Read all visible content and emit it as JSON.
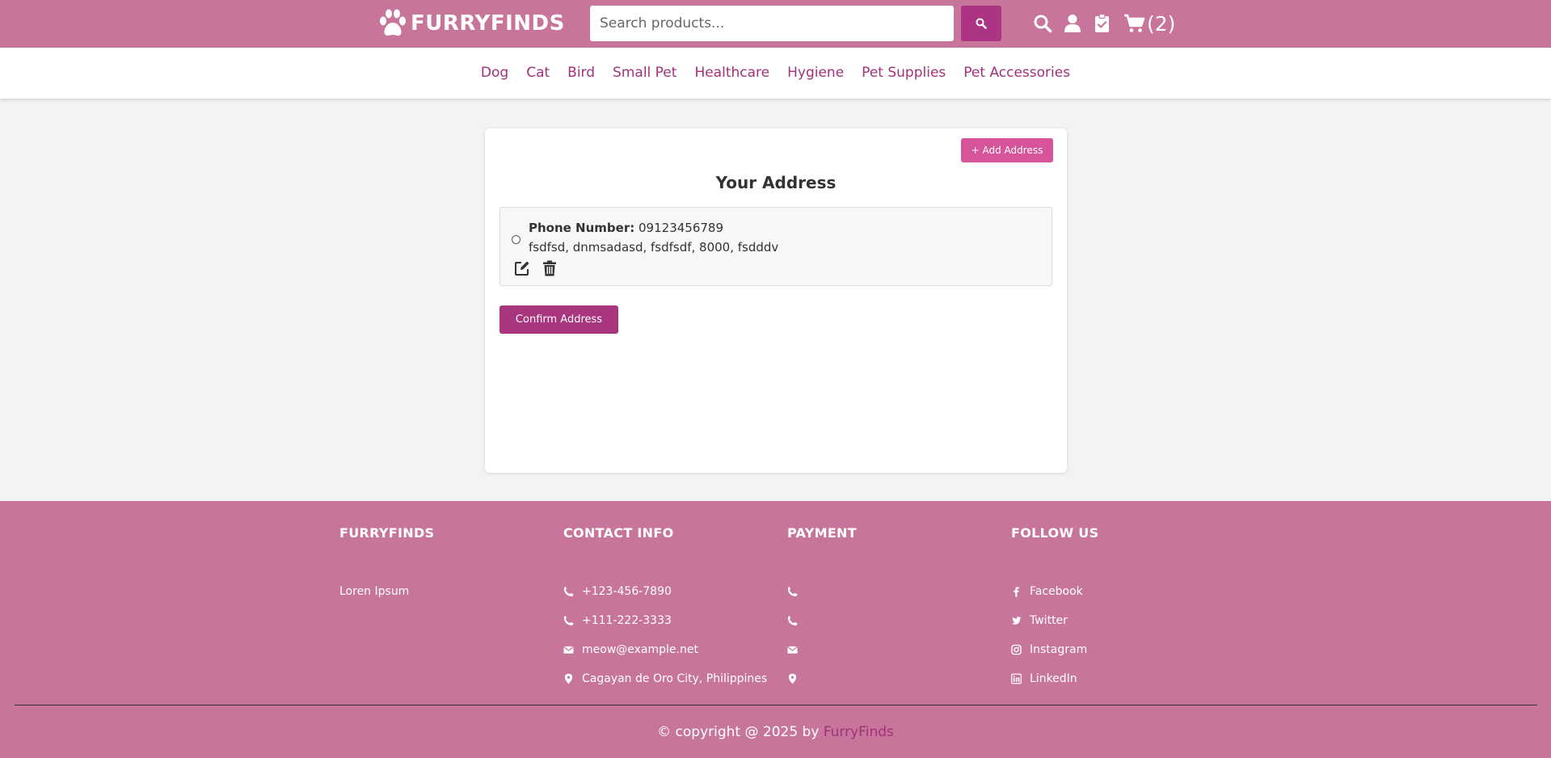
{
  "header": {
    "logo_text": "FURRYFINDS",
    "search_placeholder": "Search products...",
    "cart_count": "(2)"
  },
  "nav": [
    "Dog",
    "Cat",
    "Bird",
    "Small Pet",
    "Healthcare",
    "Hygiene",
    "Pet Supplies",
    "Pet Accessories"
  ],
  "address_card": {
    "add_button": "+ Add Address",
    "title": "Your Address",
    "entry": {
      "phone_label": "Phone Number:",
      "phone_value": "09123456789",
      "address": "fsdfsd, dnmsadasd, fsdfsdf, 8000, fsdddv"
    },
    "confirm_button": "Confirm Address"
  },
  "footer": {
    "col1_title": "FURRYFINDS",
    "col1_text": "Loren Ipsum",
    "col2_title": "CONTACT INFO",
    "contact": [
      "+123-456-7890",
      "+111-222-3333",
      "meow@example.net",
      "Cagayan de Oro City, Philippines"
    ],
    "col3_title": "PAYMENT",
    "col4_title": "FOLLOW US",
    "social": [
      "Facebook",
      "Twitter",
      "Instagram",
      "LinkedIn"
    ],
    "copyright_prefix": "© copyright @ 2025 by",
    "copyright_brand": "FurryFinds"
  },
  "colors": {
    "header_bg": "#c8759c",
    "accent": "#a9357f",
    "add_button": "#d7549a",
    "nav_link": "#a3307a"
  }
}
